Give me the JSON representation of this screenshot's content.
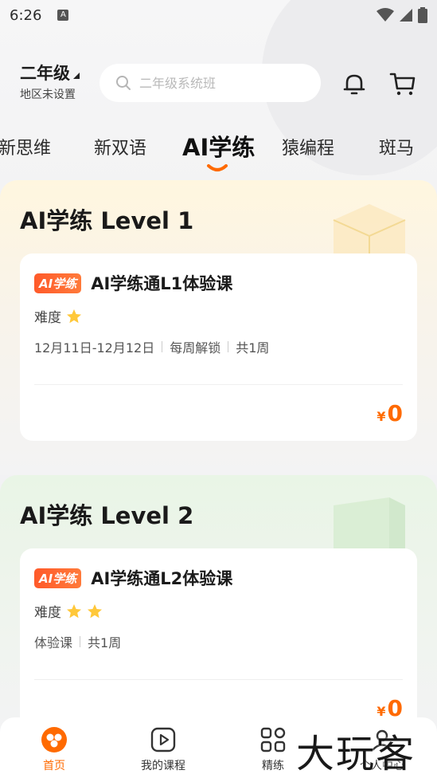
{
  "status_bar": {
    "time": "6:26",
    "notification_glyph": "A"
  },
  "header": {
    "grade": "二年级",
    "region": "地区未设置",
    "search_placeholder": "二年级系统班"
  },
  "tabs": [
    {
      "label": "新思维",
      "active": false
    },
    {
      "label": "新双语",
      "active": false
    },
    {
      "label": "AI学练",
      "active": true
    },
    {
      "label": "猿编程",
      "active": false
    },
    {
      "label": "斑马",
      "active": false
    }
  ],
  "sections": [
    {
      "title": "AI学练 Level 1",
      "course": {
        "tag": "AI学练",
        "name": "AI学练通L1体验课",
        "difficulty_label": "难度",
        "stars": 1,
        "meta": [
          "12月11日-12月12日",
          "每周解锁",
          "共1周"
        ],
        "price_symbol": "¥",
        "price": "0"
      }
    },
    {
      "title": "AI学练 Level 2",
      "course": {
        "tag": "AI学练",
        "name": "AI学练通L2体验课",
        "difficulty_label": "难度",
        "stars": 2,
        "meta": [
          "体验课",
          "共1周"
        ],
        "price_symbol": "¥",
        "price": "0"
      }
    }
  ],
  "bottom_nav": [
    {
      "label": "首页",
      "icon": "home-icon",
      "active": true
    },
    {
      "label": "我的课程",
      "icon": "play-icon",
      "active": false
    },
    {
      "label": "精练",
      "icon": "grid-icon",
      "active": false
    },
    {
      "label": "个人中心",
      "icon": "user-icon",
      "active": false
    }
  ],
  "watermark": "大玩客",
  "colors": {
    "accent": "#ff6a00",
    "tag_bg": "#ff5a2a",
    "star": "#ffc83a"
  }
}
